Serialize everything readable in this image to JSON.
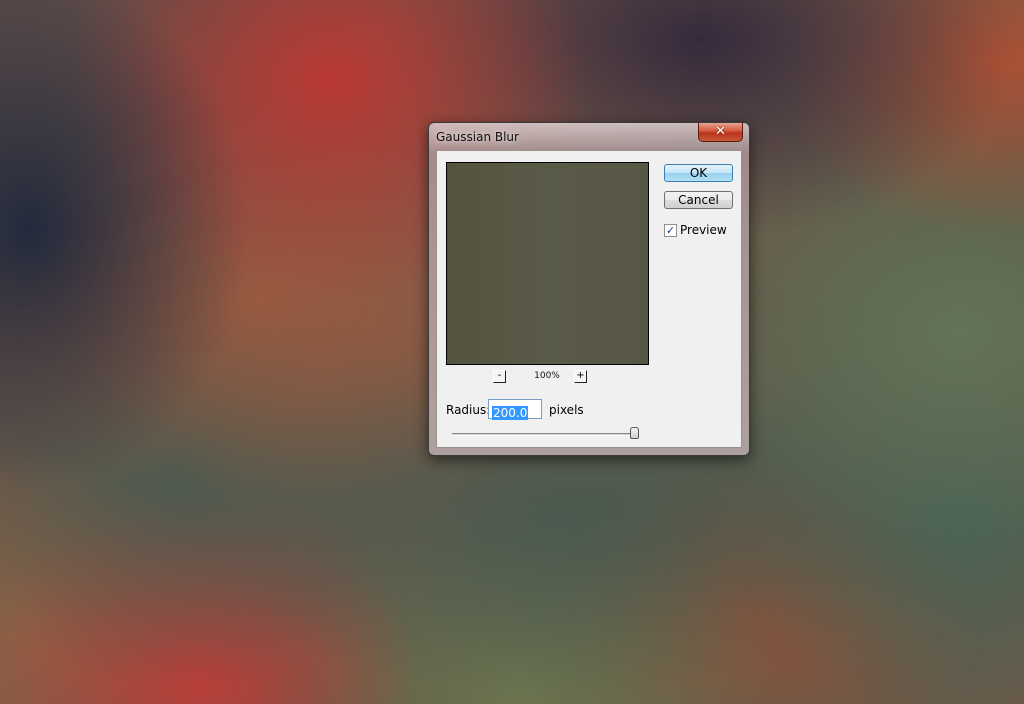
{
  "dialog": {
    "title": "Gaussian Blur",
    "close_glyph": "✕",
    "ok_label": "OK",
    "cancel_label": "Cancel",
    "preview_label": "Preview",
    "preview_checked": true,
    "check_glyph": "✓",
    "zoom": {
      "minus_label": "-",
      "plus_label": "+",
      "level": "100%"
    },
    "radius": {
      "label": "Radius:",
      "value": "200.0",
      "units": "pixels",
      "slider_fraction": 0.98
    },
    "preview_color": "#58573f",
    "accent_color": "#3399ff"
  },
  "icons": [
    "close-icon",
    "check-icon",
    "zoom-out-icon",
    "zoom-in-icon",
    "slider-thumb"
  ]
}
